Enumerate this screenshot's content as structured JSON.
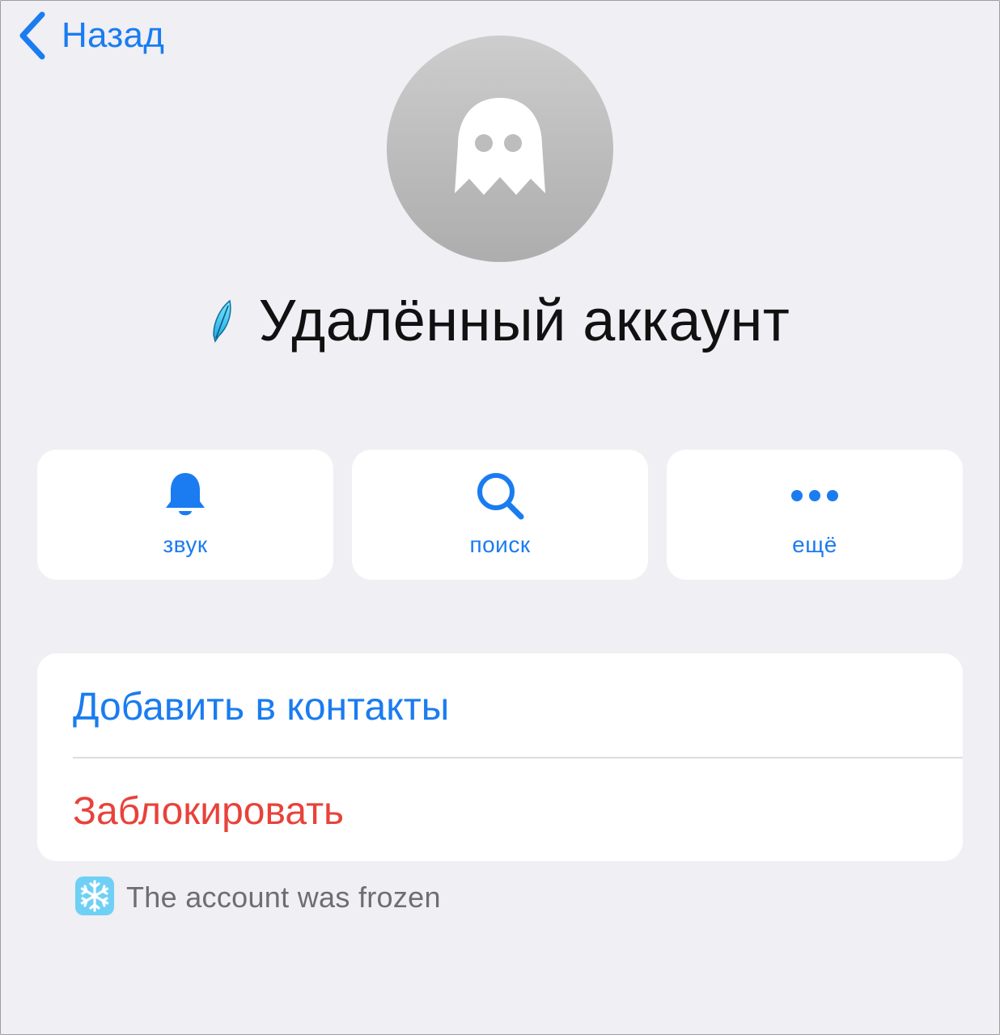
{
  "nav": {
    "back_label": "Назад"
  },
  "profile": {
    "avatar_icon": "ghost-icon",
    "status_icon": "feather-icon",
    "name": "Удалённый аккаунт"
  },
  "actions": [
    {
      "label": "звук",
      "icon": "bell-icon"
    },
    {
      "label": "поиск",
      "icon": "search-icon"
    },
    {
      "label": "ещё",
      "icon": "more-icon"
    }
  ],
  "list": {
    "add_contact": "Добавить в контакты",
    "block": "Заблокировать"
  },
  "note": {
    "icon": "snowflake-icon",
    "text": "The account was frozen"
  },
  "colors": {
    "accent": "#1a7cf0",
    "danger": "#e8423a",
    "background": "#efeff4",
    "card": "#ffffff",
    "secondary_text": "#6d6d72"
  }
}
